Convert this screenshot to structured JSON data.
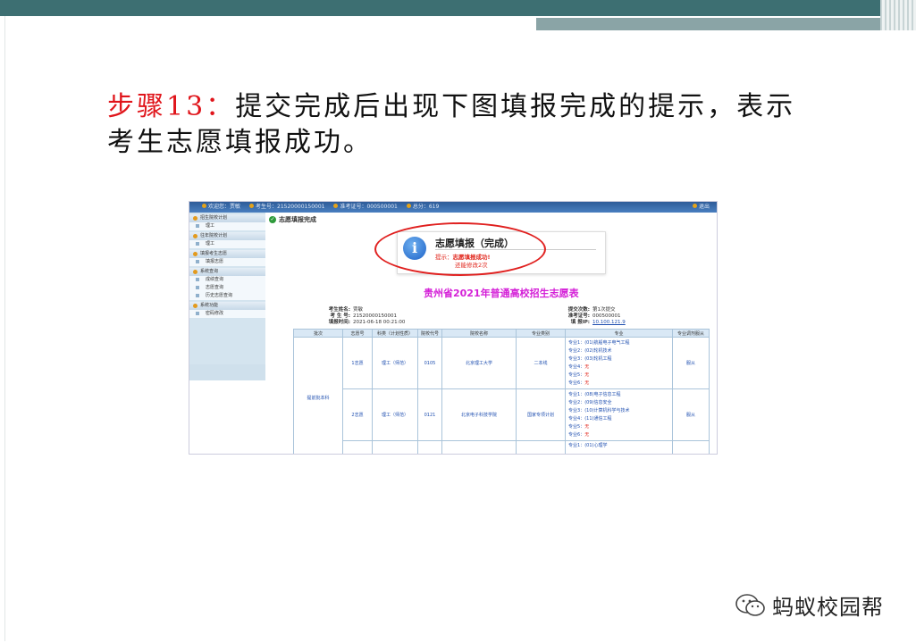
{
  "slide": {
    "step_label": "步骤13：",
    "title_text": "提交完成后出现下图填报完成的提示，表示考生志愿填报成功。"
  },
  "screenshot": {
    "topbar": {
      "fields": [
        "欢迎您：贾敏",
        "考生号：21520000150001",
        "准考证号：000500001",
        "总分：619"
      ],
      "right_label": "退出"
    },
    "sidebar": {
      "link": "折叠",
      "groups": [
        {
          "label": "招生院校计划",
          "items": [
            "理工"
          ]
        },
        {
          "label": "往年院校计划",
          "items": [
            "理工"
          ]
        },
        {
          "label": "填报考生志愿",
          "items": [
            "填报志愿"
          ]
        },
        {
          "label": "系统查询",
          "items": [
            "成绩查询",
            "志愿查询",
            "历史志愿查询"
          ]
        },
        {
          "label": "系统功能",
          "items": [
            "密码修改"
          ]
        }
      ]
    },
    "page_heading": "志愿填报完成",
    "popup": {
      "title": "志愿填报（完成）",
      "tip_prefix": "提示：",
      "tip_message": "志愿填报成功!",
      "modify_note": "还能修改2次"
    },
    "form_title": "贵州省2021年普通高校招生志愿表",
    "student_info": {
      "name_label": "考生姓名:",
      "name": "贾敏",
      "id_label": "考 生 号:",
      "id": "21520000150001",
      "time_label": "填报时间:",
      "time": "2021-06-18 00:21:00",
      "submit_label": "提交次数:",
      "submit": "第1次提交",
      "admit_label": "准考证号:",
      "admit": "000500001",
      "ip_label": "填 报IP:",
      "ip": "10.100.121.9"
    },
    "table": {
      "headers": [
        "批次",
        "志愿号",
        "科类（计划性质）",
        "院校代号",
        "院校名称",
        "专业类别",
        "专业",
        "专业调剂服从"
      ],
      "batch": "提前批本科",
      "rows": [
        {
          "no": "1志愿",
          "category": "理工（师范）",
          "code": "0105",
          "school": "北京理工大学",
          "type": "二本线",
          "majors": [
            {
              "label": "专业1：",
              "value": "(01)航船电子电气工程",
              "red": false
            },
            {
              "label": "专业2：",
              "value": "(02)轮机技术",
              "red": false
            },
            {
              "label": "专业3：",
              "value": "(03)轮机工程",
              "red": false
            },
            {
              "label": "专业4：",
              "value": "无",
              "red": true
            },
            {
              "label": "专业5：",
              "value": "无",
              "red": true
            },
            {
              "label": "专业6：",
              "value": "无",
              "red": true
            }
          ],
          "adjust": "服从"
        },
        {
          "no": "2志愿",
          "category": "理工（师范）",
          "code": "0121",
          "school": "北京电子科技学院",
          "type": "国家专项计划",
          "majors": [
            {
              "label": "专业1：",
              "value": "(08)电子信息工程",
              "red": false
            },
            {
              "label": "专业2：",
              "value": "(09)信息安全",
              "red": false
            },
            {
              "label": "专业3：",
              "value": "(10)计算机科学与技术",
              "red": false
            },
            {
              "label": "专业4：",
              "value": "(11)通信工程",
              "red": false
            },
            {
              "label": "专业5：",
              "value": "无",
              "red": true
            },
            {
              "label": "专业6：",
              "value": "无",
              "red": true
            }
          ],
          "adjust": "服从"
        },
        {
          "no": "",
          "category": "",
          "code": "",
          "school": "",
          "type": "",
          "majors": [
            {
              "label": "专业1：",
              "value": "(01)心理学",
              "red": false
            }
          ],
          "adjust": ""
        }
      ]
    }
  },
  "logo": {
    "text": "蚂蚁校园帮",
    "icon": "wechat-icon"
  }
}
